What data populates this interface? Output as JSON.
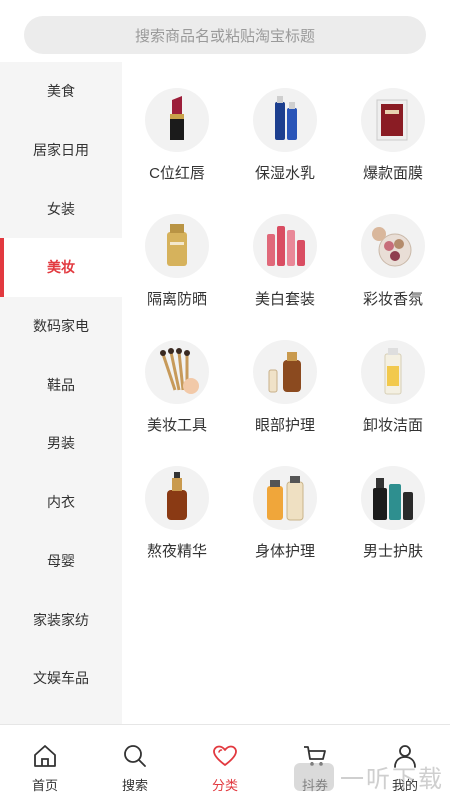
{
  "search": {
    "placeholder": "搜索商品名或粘贴淘宝标题"
  },
  "sidebar": {
    "items": [
      {
        "label": "美食"
      },
      {
        "label": "居家日用"
      },
      {
        "label": "女装"
      },
      {
        "label": "美妆",
        "active": true
      },
      {
        "label": "数码家电"
      },
      {
        "label": "鞋品"
      },
      {
        "label": "男装"
      },
      {
        "label": "内衣"
      },
      {
        "label": "母婴"
      },
      {
        "label": "家装家纺"
      },
      {
        "label": "文娱车品"
      }
    ]
  },
  "categories": {
    "items": [
      {
        "label": "C位红唇",
        "icon": "lipstick-icon"
      },
      {
        "label": "保湿水乳",
        "icon": "lotion-bottle-icon"
      },
      {
        "label": "爆款面膜",
        "icon": "face-mask-icon"
      },
      {
        "label": "隔离防晒",
        "icon": "sunscreen-icon"
      },
      {
        "label": "美白套装",
        "icon": "skincare-set-icon"
      },
      {
        "label": "彩妆香氛",
        "icon": "eyeshadow-palette-icon"
      },
      {
        "label": "美妆工具",
        "icon": "makeup-brushes-icon"
      },
      {
        "label": "眼部护理",
        "icon": "eye-serum-icon"
      },
      {
        "label": "卸妆洁面",
        "icon": "cleanser-bottle-icon"
      },
      {
        "label": "熬夜精华",
        "icon": "essence-bottle-icon"
      },
      {
        "label": "身体护理",
        "icon": "body-care-icon"
      },
      {
        "label": "男士护肤",
        "icon": "men-skincare-icon"
      }
    ]
  },
  "tabbar": {
    "tabs": [
      {
        "label": "首页",
        "icon": "home-icon"
      },
      {
        "label": "搜索",
        "icon": "search-icon"
      },
      {
        "label": "分类",
        "icon": "heart-icon",
        "active": true
      },
      {
        "label": "抖券",
        "icon": "cart-icon"
      },
      {
        "label": "我的",
        "icon": "user-icon"
      }
    ]
  },
  "watermark": {
    "text": "一听下载"
  },
  "colors": {
    "accent": "#e2393f",
    "sidebar_bg": "#f5f5f5",
    "search_bg": "#ececec"
  }
}
